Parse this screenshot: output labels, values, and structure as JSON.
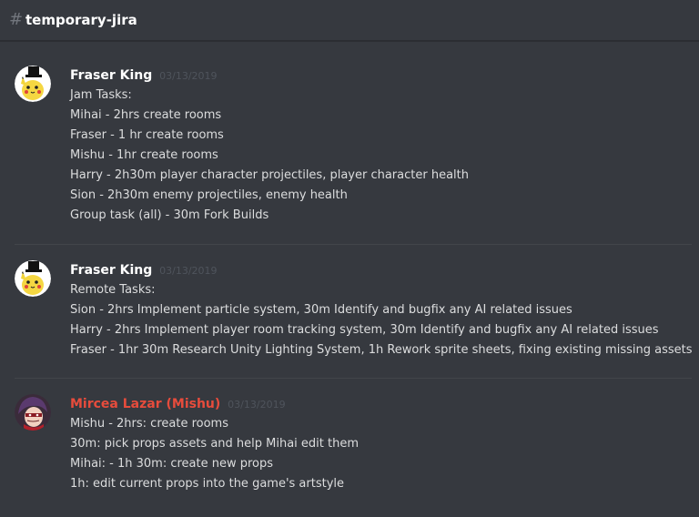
{
  "channel": {
    "hash": "#",
    "name": "temporary-jira"
  },
  "colors": {
    "background": "#36393f",
    "text": "#dcddde",
    "username_default": "#ffffff",
    "username_mishu": "#e74c3c",
    "timestamp": "#4f545c"
  },
  "messages": [
    {
      "author": "Fraser King",
      "timestamp": "03/13/2019",
      "avatar_icon": "pikachu-top-hat-avatar",
      "lines": [
        "Jam Tasks:",
        "Mihai - 2hrs create rooms",
        "Fraser - 1 hr create rooms",
        "Mishu - 1hr create rooms",
        "Harry - 2h30m player character projectiles, player character health",
        "Sion - 2h30m enemy projectiles, enemy health",
        "Group task (all) - 30m Fork Builds"
      ]
    },
    {
      "author": "Fraser King",
      "timestamp": "03/13/2019",
      "avatar_icon": "pikachu-top-hat-avatar",
      "lines": [
        "Remote Tasks:",
        "Sion - 2hrs Implement particle system, 30m Identify and bugfix any AI related issues",
        "Harry - 2hrs Implement player room tracking system, 30m Identify and bugfix any AI related issues",
        "Fraser - 1hr 30m Research Unity Lighting System, 1h Rework sprite sheets, fixing existing missing assets"
      ]
    },
    {
      "author": "Mircea Lazar (Mishu)",
      "timestamp": "03/13/2019",
      "avatar_icon": "anime-character-avatar",
      "lines": [
        "Mishu - 2hrs: create rooms",
        "30m: pick props assets and help Mihai edit them",
        "Mihai: - 1h 30m: create new props",
        "1h: edit current props into the game's artstyle"
      ]
    }
  ]
}
